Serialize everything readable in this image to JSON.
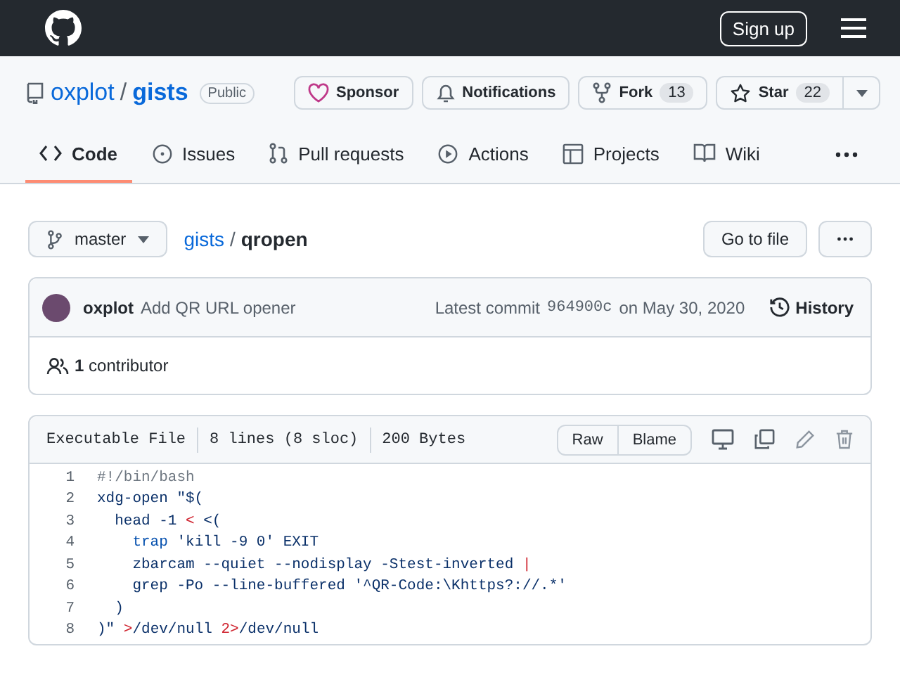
{
  "header": {
    "signup": "Sign up"
  },
  "repo": {
    "owner": "oxplot",
    "separator": "/",
    "name": "gists",
    "visibility": "Public"
  },
  "repo_actions": [
    {
      "kind": "sponsor",
      "label": "Sponsor"
    },
    {
      "kind": "notifications",
      "label": "Notifications"
    },
    {
      "kind": "fork",
      "label": "Fork",
      "count": "13"
    },
    {
      "kind": "star",
      "label": "Star",
      "count": "22"
    }
  ],
  "tabs": [
    {
      "kind": "code",
      "label": "Code",
      "selected": true
    },
    {
      "kind": "issues",
      "label": "Issues",
      "selected": false
    },
    {
      "kind": "pulls",
      "label": "Pull requests",
      "selected": false
    },
    {
      "kind": "actions",
      "label": "Actions",
      "selected": false
    },
    {
      "kind": "projects",
      "label": "Projects",
      "selected": false
    },
    {
      "kind": "wiki",
      "label": "Wiki",
      "selected": false
    }
  ],
  "branch": "master",
  "breadcrumb": {
    "repo": "gists",
    "separator": "/",
    "file": "qropen"
  },
  "go_to_file": "Go to file",
  "commit": {
    "author": "oxplot",
    "message": "Add QR URL opener",
    "prefix": "Latest commit",
    "sha": "964900c",
    "date": "on May 30, 2020",
    "history": "History"
  },
  "contributors": {
    "count": "1",
    "label": "contributor"
  },
  "file_info": [
    "Executable File",
    "8 lines (8 sloc)",
    "200 Bytes"
  ],
  "file_buttons": [
    "Raw",
    "Blame"
  ],
  "code_lines": [
    {
      "number": "1",
      "tokens": [
        {
          "kind": "comment",
          "text": "#!/bin/bash"
        }
      ]
    },
    {
      "number": "2",
      "tokens": [
        {
          "kind": "plain",
          "text": "xdg-open \"$("
        }
      ]
    },
    {
      "number": "3",
      "tokens": [
        {
          "kind": "plain",
          "text": "  head -1 "
        },
        {
          "kind": "operator",
          "text": "<"
        },
        {
          "kind": "plain",
          "text": " <("
        }
      ]
    },
    {
      "number": "4",
      "tokens": [
        {
          "kind": "builtin",
          "text": "    trap"
        },
        {
          "kind": "plain",
          "text": " 'kill -9 0' EXIT"
        }
      ]
    },
    {
      "number": "5",
      "tokens": [
        {
          "kind": "plain",
          "text": "    zbarcam --quiet --nodisplay -Stest-inverted "
        },
        {
          "kind": "operator",
          "text": "|"
        }
      ]
    },
    {
      "number": "6",
      "tokens": [
        {
          "kind": "plain",
          "text": "    grep -Po --line-buffered '^QR-Code:\\Khttps?://.*'"
        }
      ]
    },
    {
      "number": "7",
      "tokens": [
        {
          "kind": "plain",
          "text": "  )"
        }
      ]
    },
    {
      "number": "8",
      "tokens": [
        {
          "kind": "plain",
          "text": ")\" "
        },
        {
          "kind": "operator",
          "text": ">"
        },
        {
          "kind": "plain",
          "text": "/dev/null "
        },
        {
          "kind": "operator",
          "text": "2>"
        },
        {
          "kind": "plain",
          "text": "/dev/null"
        }
      ]
    }
  ]
}
